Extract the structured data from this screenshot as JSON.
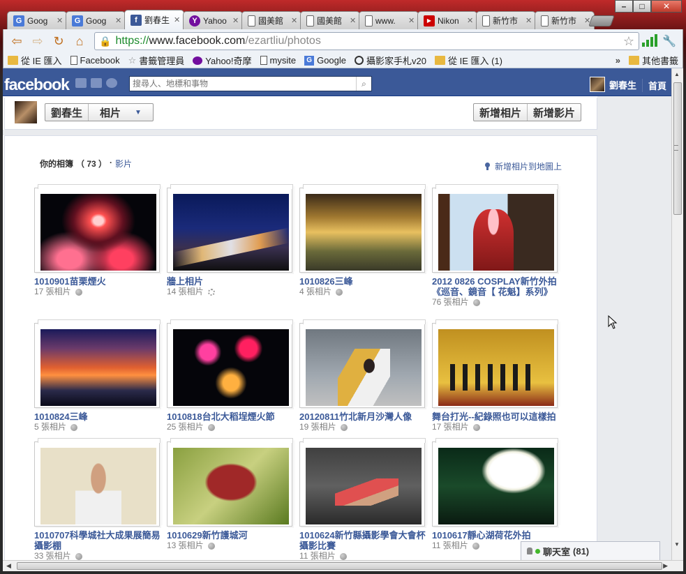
{
  "browser": {
    "tabs": [
      {
        "label": "Goog",
        "icon": "G",
        "color": "#4a7ad8"
      },
      {
        "label": "Goog",
        "icon": "G",
        "color": "#4a7ad8"
      },
      {
        "label": "劉春生",
        "icon": "f",
        "color": "#3b5998"
      },
      {
        "label": "Yahoo",
        "icon": "Y",
        "color": "#720e9e"
      },
      {
        "label": "國美館",
        "icon": "",
        "color": "#ffffff"
      },
      {
        "label": "國美館",
        "icon": "",
        "color": "#ffffff"
      },
      {
        "label": "www.",
        "icon": "",
        "color": "#ffffff"
      },
      {
        "label": "Nikon",
        "icon": "▶",
        "color": "#cc0000"
      },
      {
        "label": "新竹市",
        "icon": "",
        "color": "#ffffff"
      },
      {
        "label": "新竹市",
        "icon": "",
        "color": "#ffffff"
      }
    ],
    "url": {
      "scheme": "https://",
      "host": "www.facebook.com",
      "path": "/ezartliu/photos"
    },
    "bookmarks": [
      {
        "label": "從 IE 匯入",
        "type": "folder"
      },
      {
        "label": "Facebook",
        "type": "page"
      },
      {
        "label": "書籤管理員",
        "type": "star"
      },
      {
        "label": "Yahoo!奇摩",
        "type": "yahoo"
      },
      {
        "label": "mysite",
        "type": "page"
      },
      {
        "label": "Google",
        "type": "google"
      },
      {
        "label": "攝影家手札v20",
        "type": "circle"
      },
      {
        "label": "從 IE 匯入 (1)",
        "type": "folder"
      }
    ],
    "other_bookmarks": "其他書籤",
    "overflow": "»"
  },
  "fb": {
    "logo": "facebook",
    "search_placeholder": "搜尋人、地標和事物",
    "user": "劉春生",
    "home": "首頁"
  },
  "header": {
    "name": "劉春生",
    "section": "相片",
    "add_photos": "新增相片",
    "add_video": "新增影片"
  },
  "albums_section": {
    "title": "你的相簿",
    "count": "（ 73 ）",
    "dot": "·",
    "videos_link": "影片",
    "map_link": "新增相片到地圖上"
  },
  "albums": [
    {
      "name": "1010901苗栗煙火",
      "count": "17 張相片",
      "privacy": "globe"
    },
    {
      "name": "牆上相片",
      "count": "14 張相片",
      "privacy": "gear"
    },
    {
      "name": "1010826三峰",
      "count": "4 張相片",
      "privacy": "globe"
    },
    {
      "name": "2012 0826 COSPLAY新竹外拍《巡音、鏡音【 花魁】系列》",
      "count": "76 張相片",
      "privacy": "globe"
    },
    {
      "name": "1010824三峰",
      "count": "5 張相片",
      "privacy": "globe"
    },
    {
      "name": "1010818台北大稻埕煙火節",
      "count": "25 張相片",
      "privacy": "globe"
    },
    {
      "name": "20120811竹北新月沙灣人像",
      "count": "19 張相片",
      "privacy": "globe"
    },
    {
      "name": "舞台打光--紀錄照也可以這樣拍",
      "count": "17 張相片",
      "privacy": "globe"
    },
    {
      "name": "1010707科學城社大成果展簡易攝影棚",
      "count": "33 張相片",
      "privacy": "globe"
    },
    {
      "name": "1010629新竹護城河",
      "count": "13 張相片",
      "privacy": "globe"
    },
    {
      "name": "1010624新竹縣攝影學會大會杯攝影比賽",
      "count": "11 張相片",
      "privacy": "globe"
    },
    {
      "name": "1010617靜心湖荷花外拍",
      "count": "11 張相片",
      "privacy": "globe"
    }
  ],
  "chat": {
    "label": "聊天室",
    "count": "(81)"
  }
}
